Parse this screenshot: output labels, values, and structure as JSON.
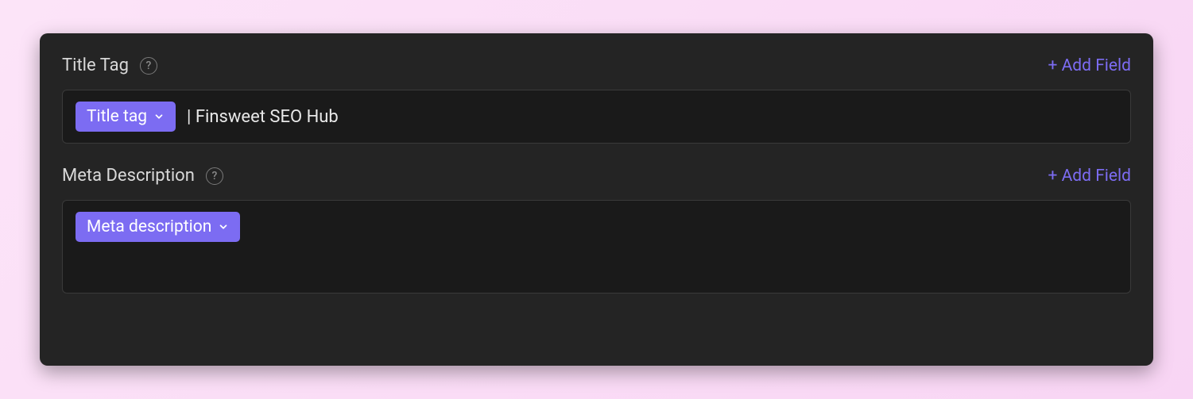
{
  "sections": {
    "title_tag": {
      "label": "Title Tag",
      "add_field_label": "+ Add Field",
      "chip_label": "Title tag",
      "value": "| Finsweet SEO Hub"
    },
    "meta_description": {
      "label": "Meta Description",
      "add_field_label": "+ Add Field",
      "chip_label": "Meta description"
    }
  },
  "colors": {
    "accent": "#7c6cf2",
    "panel_bg": "#242424",
    "input_bg": "#1a1a1a"
  }
}
